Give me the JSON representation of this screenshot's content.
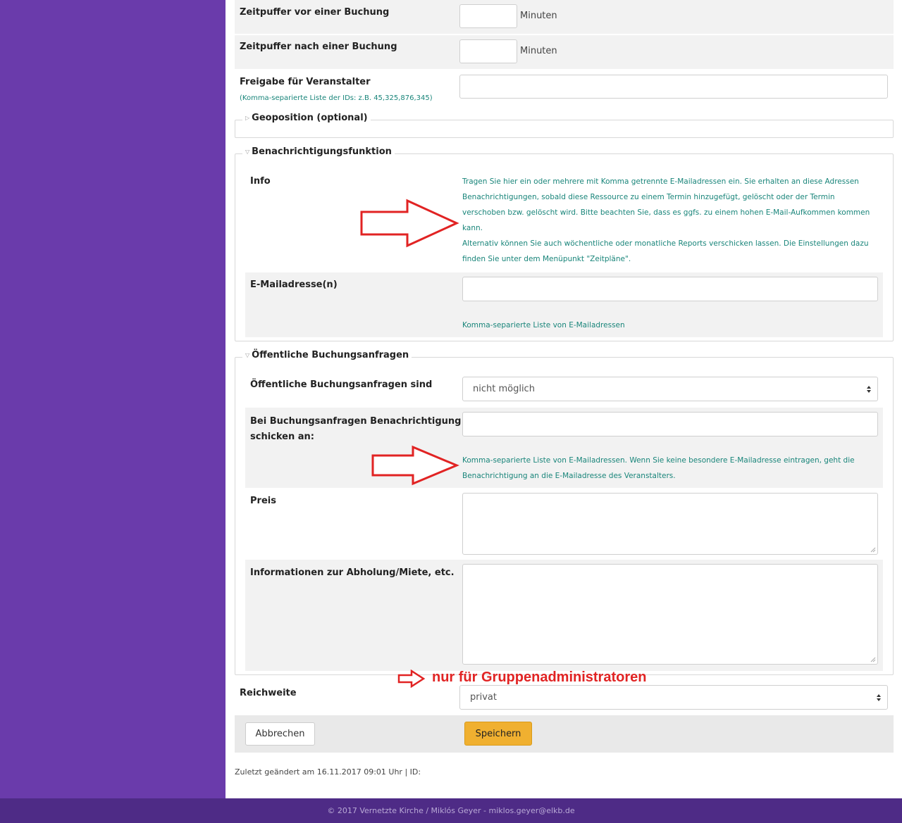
{
  "form": {
    "buffer_before": {
      "label": "Zeitpuffer vor einer Buchung",
      "value": "",
      "unit": "Minuten"
    },
    "buffer_after": {
      "label": "Zeitpuffer nach einer Buchung",
      "value": "",
      "unit": "Minuten"
    },
    "organizer_release": {
      "label": "Freigabe für Veranstalter",
      "hint": "(Komma-separierte Liste der IDs: z.B. 45,325,876,345)",
      "value": ""
    },
    "geoposition": {
      "legend": "Geoposition (optional)"
    },
    "notification": {
      "legend": "Benachrichtigungsfunktion",
      "info_label": "Info",
      "info_lines": [
        "Tragen Sie hier ein oder mehrere mit Komma getrennte E-Mailadressen ein. Sie erhalten an diese Adressen",
        "Benachrichtigungen, sobald diese Ressource zu einem Termin hinzugefügt, gelöscht oder der Termin",
        "verschoben bzw. gelöscht wird. Bitte beachten Sie, dass es ggfs. zu einem hohen E-Mail-Aufkommen kommen",
        "kann.",
        "Alternativ können Sie auch wöchentliche oder monatliche Reports verschicken lassen. Die Einstellungen dazu",
        "finden Sie unter dem Menüpunkt \"Zeitpläne\"."
      ],
      "email_label": "E-Mailadresse(n)",
      "email_value": "",
      "email_hint": "Komma-separierte Liste von E-Mailadressen"
    },
    "public_requests": {
      "legend": "Öffentliche Buchungsanfragen",
      "status_label": "Öffentliche Buchungsanfragen sind",
      "status_value": "nicht möglich",
      "notify_label_1": "Bei Buchungsanfragen Benachrichtigung",
      "notify_label_2": "schicken an:",
      "notify_value": "",
      "notify_hint_1": "Komma-separierte Liste von E-Mailadressen. Wenn Sie keine besondere E-Mailadresse eintragen, geht die",
      "notify_hint_2": "Benachrichtigung an die E-Mailadresse des Veranstalters.",
      "price_label": "Preis",
      "price_value": "",
      "pickup_label": "Informationen zur Abholung/Miete, etc.",
      "pickup_value": ""
    },
    "admin_note": "nur für Gruppenadministratoren",
    "scope": {
      "label": "Reichweite",
      "value": "privat"
    },
    "cancel_label": "Abbrechen",
    "save_label": "Speichern",
    "last_changed": "Zuletzt geändert am 16.11.2017 09:01 Uhr | ID:"
  },
  "footer": {
    "text": "© 2017 Vernetzte Kirche / Miklós Geyer - miklos.geyer@elkb.de"
  },
  "colors": {
    "sidebar": "#6a3bab",
    "footer": "#4e2b86",
    "hint": "#19857a",
    "save_button": "#f0b030",
    "annotation": "#e12323"
  }
}
